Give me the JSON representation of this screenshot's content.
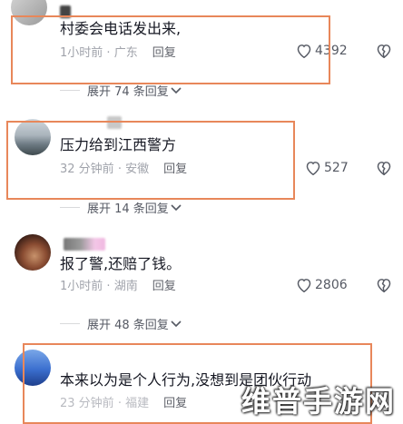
{
  "comments": [
    {
      "text": "村委会电话发出来,",
      "time": "1小时前",
      "location": "广东",
      "reply_label": "回复",
      "likes": "4392",
      "expand_label": "展开 74 条回复"
    },
    {
      "text": "压力给到江西警方",
      "time": "32 分钟前",
      "location": "安徽",
      "reply_label": "回复",
      "likes": "527",
      "expand_label": "展开 14 条回复"
    },
    {
      "text": "报了警,还赔了钱。",
      "time": "1小时前",
      "location": "湖南",
      "reply_label": "回复",
      "likes": "2806",
      "expand_label": "展开 48 条回复"
    },
    {
      "text": "本来以为是个人行为,没想到是团伙行动",
      "time": "23 分钟前",
      "location": "福建",
      "reply_label": "回复"
    }
  ],
  "separator": " · ",
  "watermark": "维普手游网",
  "colors": {
    "highlight": "#e8875a",
    "text": "#161823",
    "meta": "#a0a3ab"
  }
}
